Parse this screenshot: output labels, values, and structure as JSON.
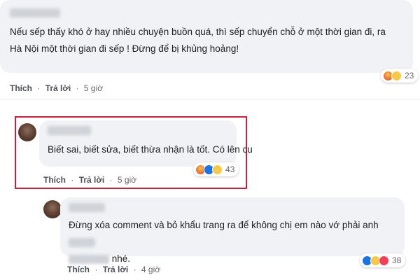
{
  "comments": [
    {
      "text_line1": "Nếu sếp thấy khó ở hay nhiều chuyện buồn quá, thì sếp chuyển chỗ ở một thời gian đi, ra",
      "text_line2": "Hà Nội một thời gian đi sếp ! Đừng để bị khủng hoảng!",
      "like": "Thích",
      "reply": "Trả lời",
      "sep": "·",
      "time": "5 giờ",
      "reaction_count": "23",
      "reaction_icons": [
        "angry-icon",
        "haha-icon"
      ]
    },
    {
      "text": "Biết sai, biết sửa, biết thừa nhận là tốt. Có lên cu",
      "like": "Thích",
      "reply": "Trả lời",
      "sep": "·",
      "time": "5 giờ",
      "reaction_count": "43",
      "reaction_icons": [
        "angry-icon",
        "like-icon",
        "wow-icon"
      ],
      "highlight_color": "#c0213c"
    },
    {
      "text_line1": "Đừng xóa comment và bỏ khẩu trang ra để không chị em nào vớ phải anh",
      "text_line2": "nhé.",
      "like": "Thích",
      "reply": "Trả lời",
      "sep": "·",
      "time": "4 giờ",
      "reaction_count": "38",
      "reaction_icons": [
        "like-icon",
        "haha-icon",
        "love-icon"
      ]
    }
  ]
}
